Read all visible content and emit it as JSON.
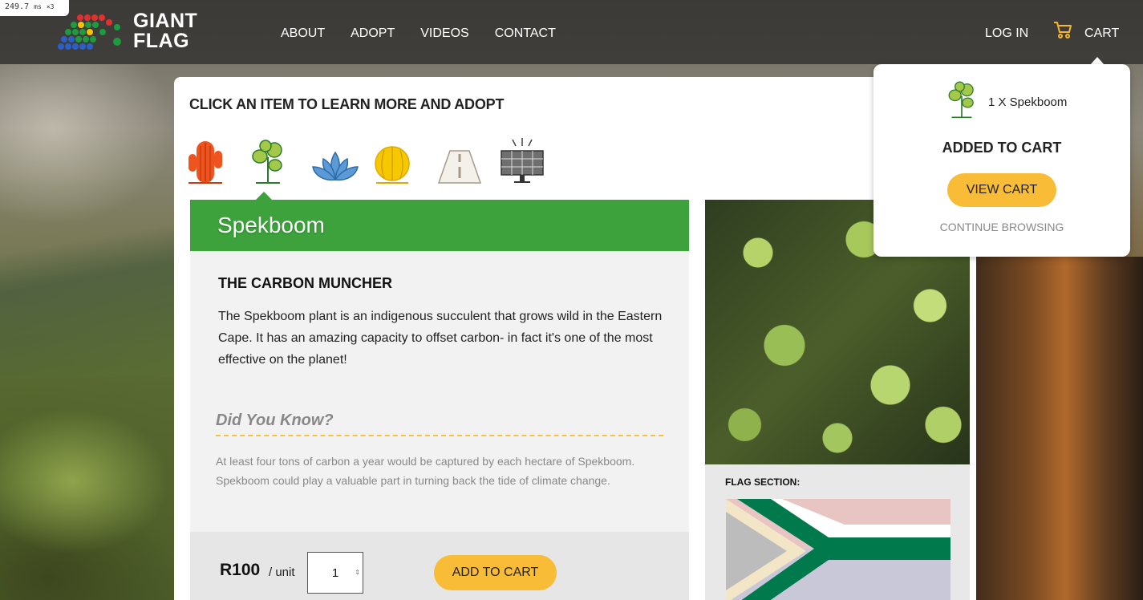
{
  "debug": {
    "frame_time": "249.7",
    "frame_unit": "ms",
    "frame_mult": "×3"
  },
  "brand": {
    "line1": "GIANT",
    "line2": "FLAG"
  },
  "nav": {
    "items": [
      "ABOUT",
      "ADOPT",
      "VIDEOS",
      "CONTACT"
    ],
    "login": "LOG IN",
    "cart": "CART"
  },
  "main": {
    "title": "CLICK AN ITEM TO LEARN MORE AND ADOPT",
    "items": [
      {
        "name": "cactus-icon"
      },
      {
        "name": "spekboom-icon",
        "selected": true
      },
      {
        "name": "lotus-icon"
      },
      {
        "name": "round-cactus-icon"
      },
      {
        "name": "road-icon"
      },
      {
        "name": "solar-panel-icon"
      }
    ],
    "heading": "Spekboom",
    "subtitle": "THE CARBON MUNCHER",
    "description": "The Spekboom plant is an indigenous succulent that grows wild in the Eastern Cape. It has an amazing capacity to offset carbon- in fact it's one of the most effective on the planet!",
    "did_you_know": "Did You Know?",
    "fact": "At least four tons of carbon a year would be captured by each hectare of Spekboom. Spekboom could play a valuable part in turning back the tide of climate change.",
    "price": "R100",
    "unit": "/ unit",
    "quantity": "1",
    "add_to_cart": "ADD TO CART",
    "flag_section_label": "FLAG SECTION:"
  },
  "popup": {
    "item": "1 X Spekboom",
    "added": "ADDED TO CART",
    "view_cart": "VIEW CART",
    "continue": "CONTINUE BROWSING"
  },
  "colors": {
    "accent": "#3da23c",
    "button": "#f9bc36"
  }
}
